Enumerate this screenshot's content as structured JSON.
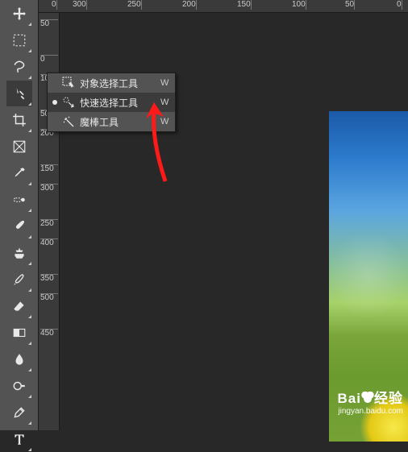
{
  "ruler_top": [
    "0",
    "300",
    "250",
    "200",
    "150",
    "100",
    "50",
    "0"
  ],
  "ruler_left": [
    "50",
    "0",
    "100",
    "50",
    "200",
    "150",
    "300",
    "250",
    "400",
    "350",
    "500",
    "450"
  ],
  "toolbox": {
    "tools": [
      "move-tool",
      "artboard-tool",
      "lasso-tool",
      "quick-select-tool",
      "crop-tool",
      "frame-tool",
      "eyedropper-tool",
      "spot-heal-tool",
      "brush-tool",
      "clone-stamp-tool",
      "history-brush-tool",
      "eraser-tool",
      "gradient-tool",
      "blur-tool",
      "dodge-tool",
      "pen-tool",
      "type-tool"
    ],
    "selected_index": 3
  },
  "flyout": {
    "items": [
      {
        "label": "对象选择工具",
        "shortcut": "W",
        "icon": "object-select-icon"
      },
      {
        "label": "快速选择工具",
        "shortcut": "W",
        "icon": "quick-select-icon"
      },
      {
        "label": "魔棒工具",
        "shortcut": "W",
        "icon": "magic-wand-icon"
      }
    ],
    "selected_index": 1
  },
  "watermark": {
    "line1_a": "Bai",
    "line1_b": "经验",
    "line2": "jingyan.baidu.com"
  },
  "colors": {
    "arrow": "#ff1a1a",
    "panel": "#535353",
    "canvas": "#282828"
  }
}
